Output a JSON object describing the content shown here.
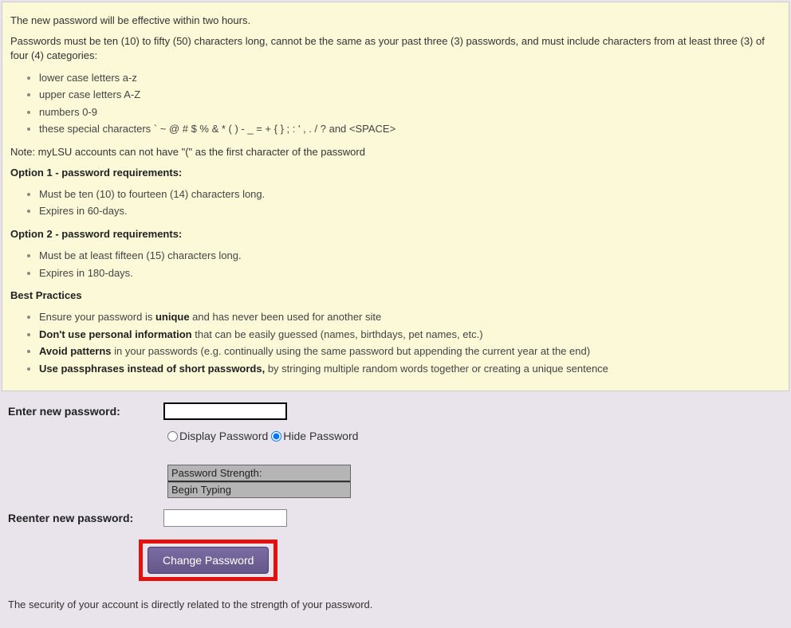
{
  "info": {
    "effective_note": "The new password will be effective within two hours.",
    "rules_intro": "Passwords must be ten (10) to fifty (50) characters long, cannot be the same as your past three (3) passwords, and must include characters from at least three (3) of four (4) categories:",
    "categories": [
      "lower case letters a-z",
      "upper case letters A-Z",
      "numbers 0-9",
      "these special characters ` ~ @ # $ % & * ( ) - _ = + { } ; : ' , . / ? and <SPACE>"
    ],
    "mylsu_note": "Note: myLSU accounts can not have \"(\" as the first character of the password",
    "option1_heading": "Option 1 - password requirements:",
    "option1_items": [
      "Must be ten (10) to fourteen (14) characters long.",
      "Expires in 60-days."
    ],
    "option2_heading": "Option 2 - password requirements:",
    "option2_items": [
      "Must be at least fifteen (15) characters long.",
      "Expires in 180-days."
    ],
    "best_practices_heading": "Best Practices",
    "bp1_pre": "Ensure your password is ",
    "bp1_bold": "unique",
    "bp1_post": " and has never been used for another site",
    "bp2_bold": "Don't use personal information",
    "bp2_post": " that can be easily guessed (names, birthdays, pet names, etc.)",
    "bp3_bold": "Avoid patterns",
    "bp3_post": " in your passwords (e.g. continually using the same password but appending the current year at the end)",
    "bp4_bold": "Use passphrases instead of short passwords,",
    "bp4_post": " by stringing multiple random words together or creating a unique sentence"
  },
  "form": {
    "enter_label": "Enter new password:",
    "reenter_label": "Reenter new password:",
    "display_label": "Display Password",
    "hide_label": "Hide Password",
    "strength_title": "Password Strength:",
    "strength_status": "Begin Typing",
    "change_button": "Change Password",
    "footer": "The security of your account is directly related to the strength of your password."
  }
}
